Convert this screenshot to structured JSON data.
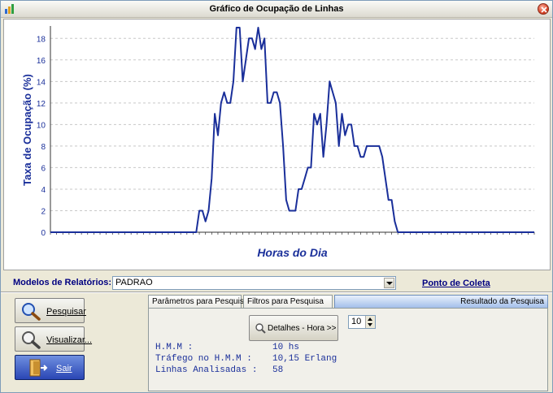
{
  "window": {
    "title": "Gráfico de Ocupação de Linhas"
  },
  "chart_data": {
    "type": "line",
    "ylabel": "Taxa de Ocupação (%)",
    "xlabel": "Horas do Dia",
    "ylim": [
      0,
      19
    ],
    "yticks": [
      0,
      2,
      4,
      6,
      8,
      10,
      12,
      14,
      16,
      18
    ],
    "grid": true,
    "line_color": "#1a2f9a",
    "series": [
      {
        "values": [
          0,
          0,
          0,
          0,
          0,
          0,
          0,
          0,
          0,
          0,
          0,
          0,
          0,
          0,
          0,
          0,
          0,
          0,
          0,
          0,
          0,
          0,
          0,
          0,
          0,
          0,
          0,
          0,
          0,
          0,
          0,
          0,
          0,
          0,
          0,
          0,
          0,
          0,
          0,
          0,
          0,
          0,
          0,
          0,
          0,
          0,
          0,
          0,
          2,
          2,
          1,
          2,
          5,
          11,
          9,
          12,
          13,
          12,
          12,
          14,
          19,
          19,
          14,
          16,
          18,
          18,
          17,
          19,
          17,
          18,
          12,
          12,
          13,
          13,
          12,
          8,
          3,
          2,
          2,
          2,
          4,
          4,
          5,
          6,
          6,
          11,
          10,
          11,
          7,
          10,
          14,
          13,
          12,
          8,
          11,
          9,
          10,
          10,
          8,
          8,
          7,
          7,
          8,
          8,
          8,
          8,
          8,
          7,
          5,
          3,
          3,
          1,
          0,
          0,
          0,
          0,
          0,
          0,
          0,
          0,
          0,
          0,
          0,
          0,
          0,
          0,
          0,
          0,
          0,
          0,
          0,
          0,
          0,
          0,
          0,
          0,
          0,
          0,
          0,
          0,
          0,
          0,
          0,
          0,
          0,
          0,
          0,
          0,
          0,
          0,
          0,
          0,
          0,
          0,
          0,
          0,
          0
        ]
      }
    ]
  },
  "models": {
    "label": "Modelos de Relatórios:",
    "value": "PADRAO",
    "link": "Ponto de Coleta"
  },
  "buttons": {
    "pesquisar": "Pesquisar",
    "visualizar": "Visualizar...",
    "sair": "Sair"
  },
  "tabs": [
    {
      "label": "Parâmetros para Pesquisa"
    },
    {
      "label": "Filtros para Pesquisa"
    },
    {
      "label": "Resultado da Pesquisa"
    }
  ],
  "result": {
    "detalhes_label": "Detalhes - Hora >>",
    "spin_value": "10",
    "rows": [
      {
        "label": "H.M.M :",
        "value": "10 hs"
      },
      {
        "label": "Tráfego no H.M.M :",
        "value": "10,15 Erlang"
      },
      {
        "label": "Linhas Analisadas :",
        "value": "58"
      }
    ]
  },
  "icons": {
    "app": "chart-app-icon",
    "close": "close-icon",
    "pesquisar": "magnifier-icon",
    "visualizar": "magnifier-icon",
    "sair": "exit-door-icon",
    "detalhes": "magnifier-small-icon"
  }
}
